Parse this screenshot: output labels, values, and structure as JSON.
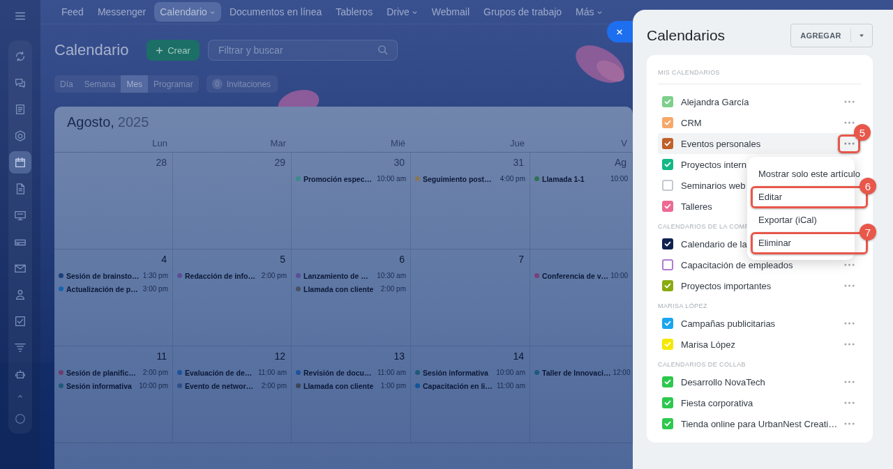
{
  "sidebar": {
    "items": [
      {
        "kind": "refresh",
        "selected": false
      },
      {
        "kind": "chat",
        "selected": false
      },
      {
        "kind": "news",
        "selected": false
      },
      {
        "kind": "hexagon",
        "selected": false
      },
      {
        "kind": "calendar",
        "selected": true
      },
      {
        "kind": "document",
        "selected": false
      },
      {
        "kind": "monitor",
        "selected": false
      },
      {
        "kind": "drive",
        "selected": false
      },
      {
        "kind": "mail",
        "selected": false
      },
      {
        "kind": "contacts",
        "selected": false
      },
      {
        "kind": "tasks",
        "selected": false
      },
      {
        "kind": "filter",
        "selected": false
      },
      {
        "kind": "robot",
        "selected": false
      }
    ]
  },
  "top_nav": {
    "items": [
      {
        "label": "Feed",
        "selected": false,
        "dropdown": false
      },
      {
        "label": "Messenger",
        "selected": false,
        "dropdown": false
      },
      {
        "label": "Calendario",
        "selected": true,
        "dropdown": true
      },
      {
        "label": "Documentos en línea",
        "selected": false,
        "dropdown": false
      },
      {
        "label": "Tableros",
        "selected": false,
        "dropdown": false
      },
      {
        "label": "Drive",
        "selected": false,
        "dropdown": true
      },
      {
        "label": "Webmail",
        "selected": false,
        "dropdown": false
      },
      {
        "label": "Grupos de trabajo",
        "selected": false,
        "dropdown": false
      },
      {
        "label": "Más",
        "selected": false,
        "dropdown": true
      }
    ]
  },
  "header": {
    "title": "Calendario",
    "create_button": "Crear",
    "search": {
      "placeholder": "Filtrar y buscar"
    }
  },
  "view_tabs": [
    {
      "label": "Día",
      "selected": false
    },
    {
      "label": "Semana",
      "selected": false
    },
    {
      "label": "Mes",
      "selected": true
    },
    {
      "label": "Programar",
      "selected": false
    }
  ],
  "invitations": {
    "count": "0",
    "label": "Invitaciones"
  },
  "calendar": {
    "month": "Agosto,",
    "year": "2025",
    "weekdays": [
      "Lun",
      "Mar",
      "Mié",
      "Jue",
      "V"
    ],
    "weeks": [
      [
        {
          "day": "28",
          "other_month": true
        },
        {
          "day": "29",
          "other_month": true
        },
        {
          "day": "30",
          "other_month": true,
          "events": [
            {
              "title": "Promoción espec…",
              "time": "10:00 am",
              "color": "#3b8c8a"
            }
          ]
        },
        {
          "day": "31",
          "other_month": true,
          "events": [
            {
              "title": "Seguimiento post…",
              "time": "4:00 pm",
              "color": "#8a7656"
            }
          ]
        },
        {
          "day": "Ag",
          "other_month": true,
          "events": [
            {
              "title": "Llamada 1-1",
              "time": "10:00",
              "color": "#2f7355"
            }
          ]
        }
      ],
      [
        {
          "day": "4",
          "other_month": false,
          "events": [
            {
              "title": "Sesión de brainsto…",
              "time": "1:30 pm",
              "color": "#1d3f78"
            },
            {
              "title": "Actualización de p…",
              "time": "3:00 pm",
              "color": "#1565b5"
            }
          ]
        },
        {
          "day": "5",
          "other_month": false,
          "events": [
            {
              "title": "Redacción de info…",
              "time": "2:00 pm",
              "color": "#5a4f96"
            }
          ]
        },
        {
          "day": "6",
          "other_month": false,
          "events": [
            {
              "title": "Lanzamiento de …",
              "time": "10:30 am",
              "color": "#5a4f96"
            },
            {
              "title": "Llamada con cliente",
              "time": "2:00 pm",
              "color": "#4b5163"
            }
          ]
        },
        {
          "day": "7",
          "other_month": false
        },
        {
          "events": [
            {
              "title": "Conferencia de v…",
              "time": "10:00",
              "color": "#7a3f78"
            }
          ]
        }
      ],
      [
        {
          "day": "11",
          "other_month": false,
          "events": [
            {
              "title": "Sesión de planific…",
              "time": "2:00 pm",
              "color": "#6b3d6e"
            },
            {
              "title": "Sesión informativa",
              "time": "10:00 pm",
              "color": "#1f5a7a"
            }
          ]
        },
        {
          "day": "12",
          "other_month": false,
          "events": [
            {
              "title": "Evaluación de de…",
              "time": "11:00 am",
              "color": "#1c53a0"
            },
            {
              "title": "Evento de networ…",
              "time": "2:00 pm",
              "color": "#2b4f86"
            }
          ]
        },
        {
          "day": "13",
          "other_month": false,
          "events": [
            {
              "title": "Revisión de docu…",
              "time": "11:00 am",
              "color": "#1c53a0"
            },
            {
              "title": "Llamada con cliente",
              "time": "1:00 pm",
              "color": "#3d4658"
            }
          ]
        },
        {
          "day": "14",
          "other_month": false,
          "events": [
            {
              "title": "Sesión informativa",
              "time": "10:00 am",
              "color": "#1f5a7a"
            },
            {
              "title": "Capacitación en li…",
              "time": "11:00 am",
              "color": "#12559a"
            }
          ]
        },
        {
          "events": [
            {
              "title": "Taller de Innovaci…",
              "time": "12:00",
              "color": "#1f5a7a"
            }
          ]
        }
      ]
    ]
  },
  "panel": {
    "title": "Calendarios",
    "add_button": "AGREGAR",
    "sections": [
      {
        "title": "MIS CALENDARIOS",
        "items": [
          {
            "label": "Alejandra García",
            "color": "#7dcf8a",
            "checked": true,
            "selected": false,
            "more": true
          },
          {
            "label": "CRM",
            "color": "#f6a86a",
            "checked": true,
            "selected": false,
            "more": true
          },
          {
            "label": "Eventos personales",
            "color": "#c0602a",
            "checked": true,
            "selected": true,
            "more": true,
            "step": "5"
          },
          {
            "label": "Proyectos intern",
            "color": "#12b886",
            "checked": true,
            "selected": false
          },
          {
            "label": "Seminarios web",
            "color": "#c4c9d0",
            "checked": false,
            "selected": false
          },
          {
            "label": "Talleres",
            "color": "#ec6a93",
            "checked": true,
            "selected": false
          }
        ]
      },
      {
        "title": "CALENDARIOS DE LA COMP",
        "items": [
          {
            "label": "Calendario de la",
            "color": "#0e2250",
            "checked": true,
            "selected": false
          },
          {
            "label": "Capacitación de empleados",
            "color": "#b27ad0",
            "checked": false,
            "selected": false,
            "more": true
          },
          {
            "label": "Proyectos importantes",
            "color": "#8aab10",
            "checked": true,
            "selected": false,
            "more": true
          }
        ]
      },
      {
        "title": "MARISA LÓPEZ",
        "items": [
          {
            "label": "Campañas publicitarias",
            "color": "#1aa5f0",
            "checked": true,
            "selected": false,
            "more": true
          },
          {
            "label": "Marisa López",
            "color": "#f4e800",
            "checked": true,
            "selected": false,
            "more": true
          }
        ]
      },
      {
        "title": "CALENDARIOS DE COLLAB",
        "items": [
          {
            "label": "Desarrollo NovaTech",
            "color": "#2dc84d",
            "checked": true,
            "selected": false,
            "more": true
          },
          {
            "label": "Fiesta corporativa",
            "color": "#2dc84d",
            "checked": true,
            "selected": false,
            "more": true
          },
          {
            "label": "Tienda online para UrbanNest Creati…",
            "color": "#2dc84d",
            "checked": true,
            "selected": false,
            "more": true
          }
        ]
      }
    ],
    "context_menu": {
      "items": [
        {
          "label": "Mostrar solo este artículo"
        },
        {
          "label": "Editar",
          "step": "6"
        },
        {
          "label": "Exportar (iCal)"
        },
        {
          "label": "Eliminar",
          "step": "7"
        }
      ]
    }
  }
}
